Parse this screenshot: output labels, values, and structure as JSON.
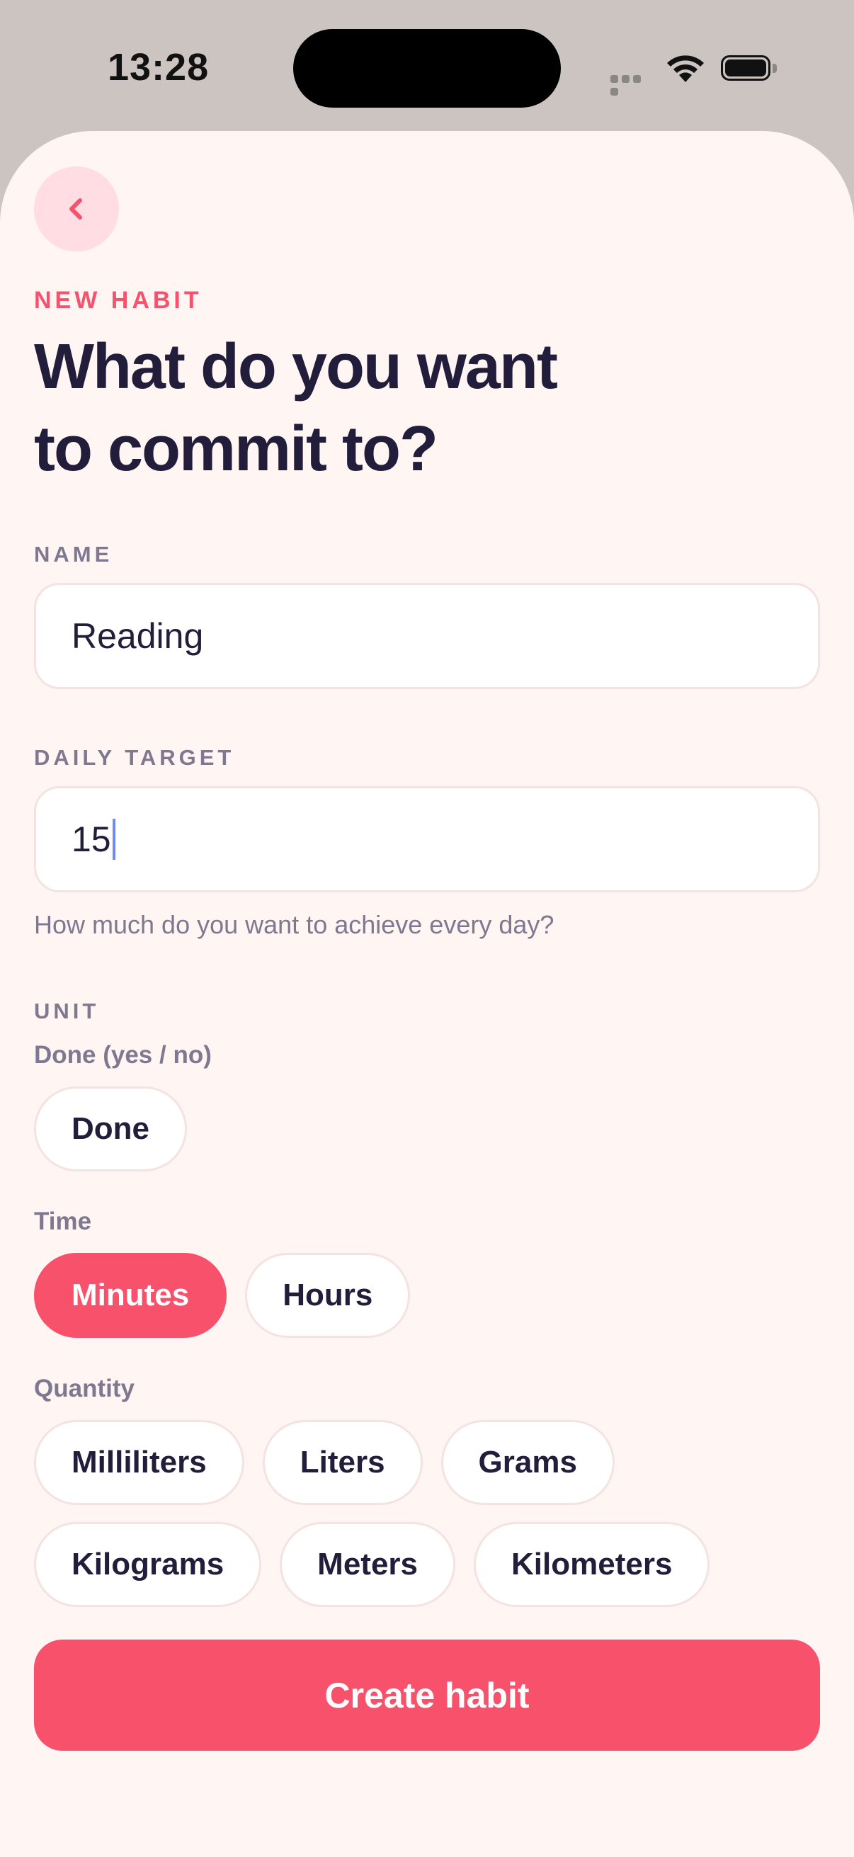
{
  "status_bar": {
    "time": "13:28",
    "icons": [
      "cellular-signal-icon",
      "wifi-icon",
      "battery-icon"
    ]
  },
  "header": {
    "back_icon": "chevron-left-icon",
    "eyebrow": "NEW HABIT",
    "title_line1": "What do you want",
    "title_line2": "to commit to?"
  },
  "form": {
    "name": {
      "label": "NAME",
      "value": "Reading"
    },
    "daily_target": {
      "label": "DAILY TARGET",
      "value": "15",
      "helper": "How much do you want to achieve every day?"
    },
    "unit": {
      "label": "UNIT",
      "groups": [
        {
          "label": "Done (yes / no)",
          "options": [
            "Done"
          ]
        },
        {
          "label": "Time",
          "options": [
            "Minutes",
            "Hours"
          ],
          "selected": "Minutes"
        },
        {
          "label": "Quantity",
          "options": [
            "Milliliters",
            "Liters",
            "Grams",
            "Kilograms",
            "Meters",
            "Kilometers"
          ]
        }
      ]
    },
    "submit_label": "Create habit"
  },
  "colors": {
    "accent": "#f8516b",
    "background": "#fff5f2",
    "text_primary": "#221d3a",
    "text_secondary": "#7f7891"
  }
}
